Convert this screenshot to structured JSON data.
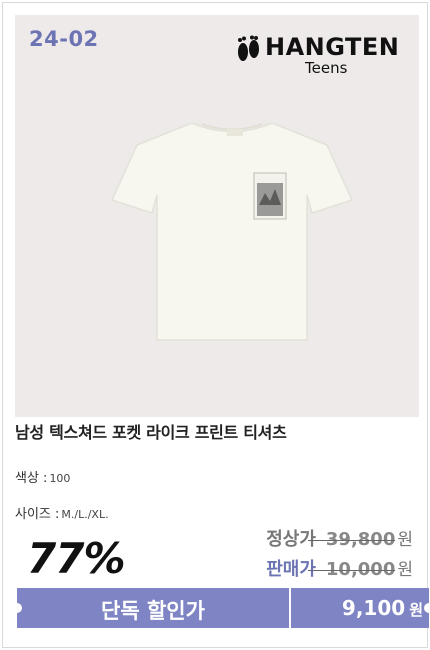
{
  "product_code": "24-02",
  "brand": {
    "name": "HANGTEN",
    "sub": "Teens"
  },
  "product": {
    "title": "남성 텍스쳐드 포켓 라이크 프린트 티셔츠"
  },
  "options": {
    "color_label": "색상 :",
    "color_value": "100",
    "size_label": "사이즈 :",
    "size_value": "M./L./XL."
  },
  "pricing": {
    "discount": "77%",
    "regular_label": "정상가",
    "regular_price": "39,800",
    "sale_label": "판매가",
    "sale_price": "10,000",
    "unit": "원"
  },
  "deal_bar": {
    "label": "단독 할인가",
    "price": "9,100",
    "unit": "원"
  },
  "colors": {
    "accent": "#7f85c4",
    "code_text": "#6d74b3",
    "photo_bg": "#efeaea"
  }
}
